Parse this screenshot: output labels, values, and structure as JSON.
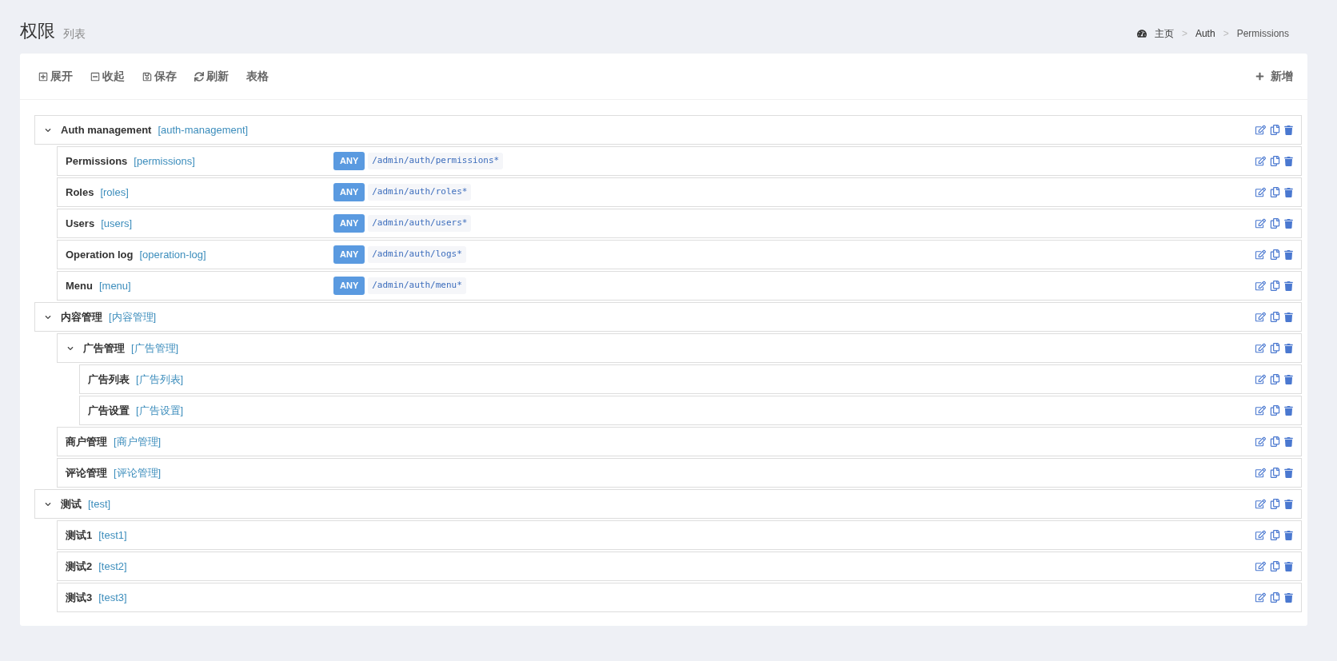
{
  "header": {
    "title": "权限",
    "subtitle": "列表"
  },
  "breadcrumb": [
    "主页",
    "Auth",
    "Permissions"
  ],
  "breadcrumb_separator": ">",
  "toolbar": {
    "buttons": [
      {
        "kind": "expand",
        "label": "展开"
      },
      {
        "kind": "collapse",
        "label": "收起"
      },
      {
        "kind": "save",
        "label": "保存"
      },
      {
        "kind": "refresh",
        "label": "刷新"
      },
      {
        "kind": "plain",
        "label": "表格"
      }
    ],
    "add_button": "新增"
  },
  "tree": [
    {
      "name": "Auth management",
      "slug": "[auth-management]",
      "expanded": true,
      "children": [
        {
          "name": "Permissions",
          "slug": "[permissions]",
          "method": "ANY",
          "path": "/admin/auth/permissions*"
        },
        {
          "name": "Roles",
          "slug": "[roles]",
          "method": "ANY",
          "path": "/admin/auth/roles*"
        },
        {
          "name": "Users",
          "slug": "[users]",
          "method": "ANY",
          "path": "/admin/auth/users*"
        },
        {
          "name": "Operation log",
          "slug": "[operation-log]",
          "method": "ANY",
          "path": "/admin/auth/logs*"
        },
        {
          "name": "Menu",
          "slug": "[menu]",
          "method": "ANY",
          "path": "/admin/auth/menu*"
        }
      ]
    },
    {
      "name": "内容管理",
      "slug": "[内容管理]",
      "expanded": true,
      "children": [
        {
          "name": "广告管理",
          "slug": "[广告管理]",
          "expanded": true,
          "children": [
            {
              "name": "广告列表",
              "slug": "[广告列表]"
            },
            {
              "name": "广告设置",
              "slug": "[广告设置]"
            }
          ]
        },
        {
          "name": "商户管理",
          "slug": "[商户管理]"
        },
        {
          "name": "评论管理",
          "slug": "[评论管理]"
        }
      ]
    },
    {
      "name": "测试",
      "slug": "[test]",
      "expanded": true,
      "children": [
        {
          "name": "测试1",
          "slug": "[test1]"
        },
        {
          "name": "测试2",
          "slug": "[test2]"
        },
        {
          "name": "测试3",
          "slug": "[test3]"
        }
      ]
    }
  ]
}
